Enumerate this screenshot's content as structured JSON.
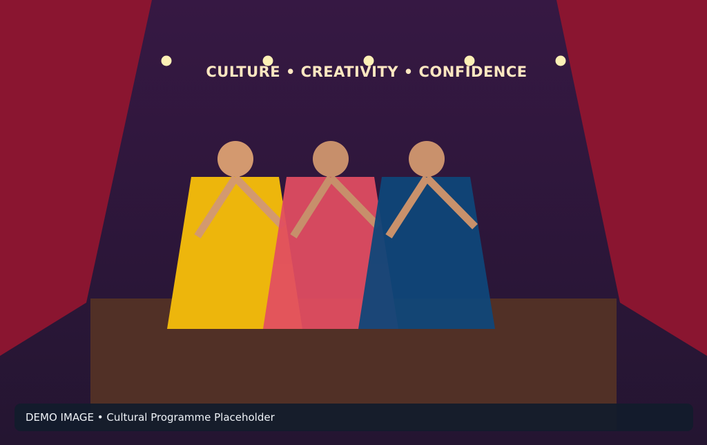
{
  "banner": {
    "text": "CULTURE • CREATIVITY • CONFIDENCE"
  },
  "caption": {
    "text": "DEMO IMAGE • Cultural Programme Placeholder"
  },
  "colors": {
    "backdrop_top": "#351842",
    "backdrop_bottom": "#22142e",
    "curtain": "#8a1530",
    "stage_floor": "#513026",
    "stage_lights": "#fdf0b6",
    "skin": "#d3996f",
    "figure_left": "#edb60c",
    "figure_middle": "#d84860",
    "figure_right": "#114577",
    "caption_bar": "#121c2c",
    "text_light": "#fde7c1"
  },
  "scene": {
    "elements": [
      "curtain-left",
      "curtain-right",
      "stage-platform",
      "stage-lights",
      "figure-yellow",
      "figure-pink",
      "figure-blue"
    ]
  }
}
